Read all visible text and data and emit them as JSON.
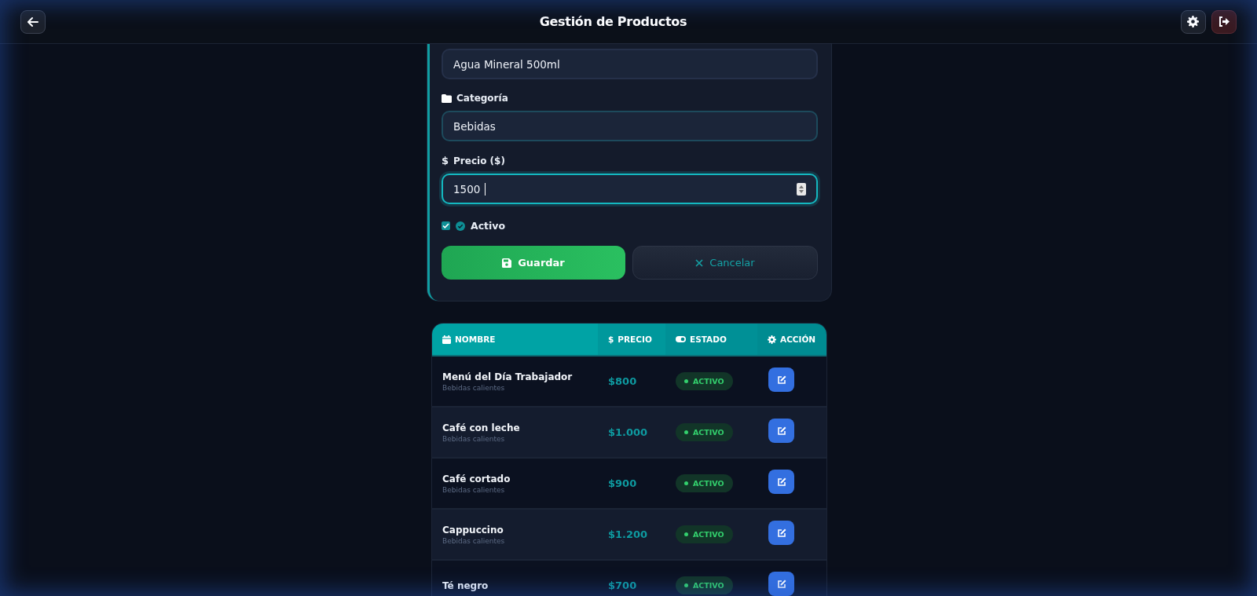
{
  "header": {
    "title": "Gestión de Productos"
  },
  "form": {
    "name_value": "Agua Mineral 500ml",
    "category": {
      "label": "Categoría",
      "value": "Bebidas"
    },
    "price": {
      "icon": "$",
      "label": "Precio ($)",
      "value": "1500",
      "focused": true
    },
    "active": {
      "label": "Activo",
      "checked": true
    },
    "save": "Guardar",
    "cancel": "Cancelar"
  },
  "table": {
    "columns": [
      {
        "label": "NOMBRE",
        "kind": "calendar"
      },
      {
        "label": "PRECIO",
        "kind": "dollar",
        "icon": "$"
      },
      {
        "label": "ESTADO",
        "kind": "toggle"
      },
      {
        "label": "ACCIÓN",
        "kind": "gear"
      }
    ],
    "rows": [
      {
        "name": "Menú del Día Trabajador",
        "category": "Bebidas calientes",
        "price": "$800",
        "status": "ACTIVO",
        "active": true
      },
      {
        "name": "Café con leche",
        "category": "Bebidas calientes",
        "price": "$1.000",
        "status": "ACTIVO",
        "active": true
      },
      {
        "name": "Café cortado",
        "category": "Bebidas calientes",
        "price": "$900",
        "status": "ACTIVO",
        "active": true
      },
      {
        "name": "Cappuccino",
        "category": "Bebidas calientes",
        "price": "$1.200",
        "status": "ACTIVO",
        "active": true
      },
      {
        "name": "Té negro",
        "price": "$700",
        "status": "ACTIVO",
        "active": true
      }
    ]
  }
}
